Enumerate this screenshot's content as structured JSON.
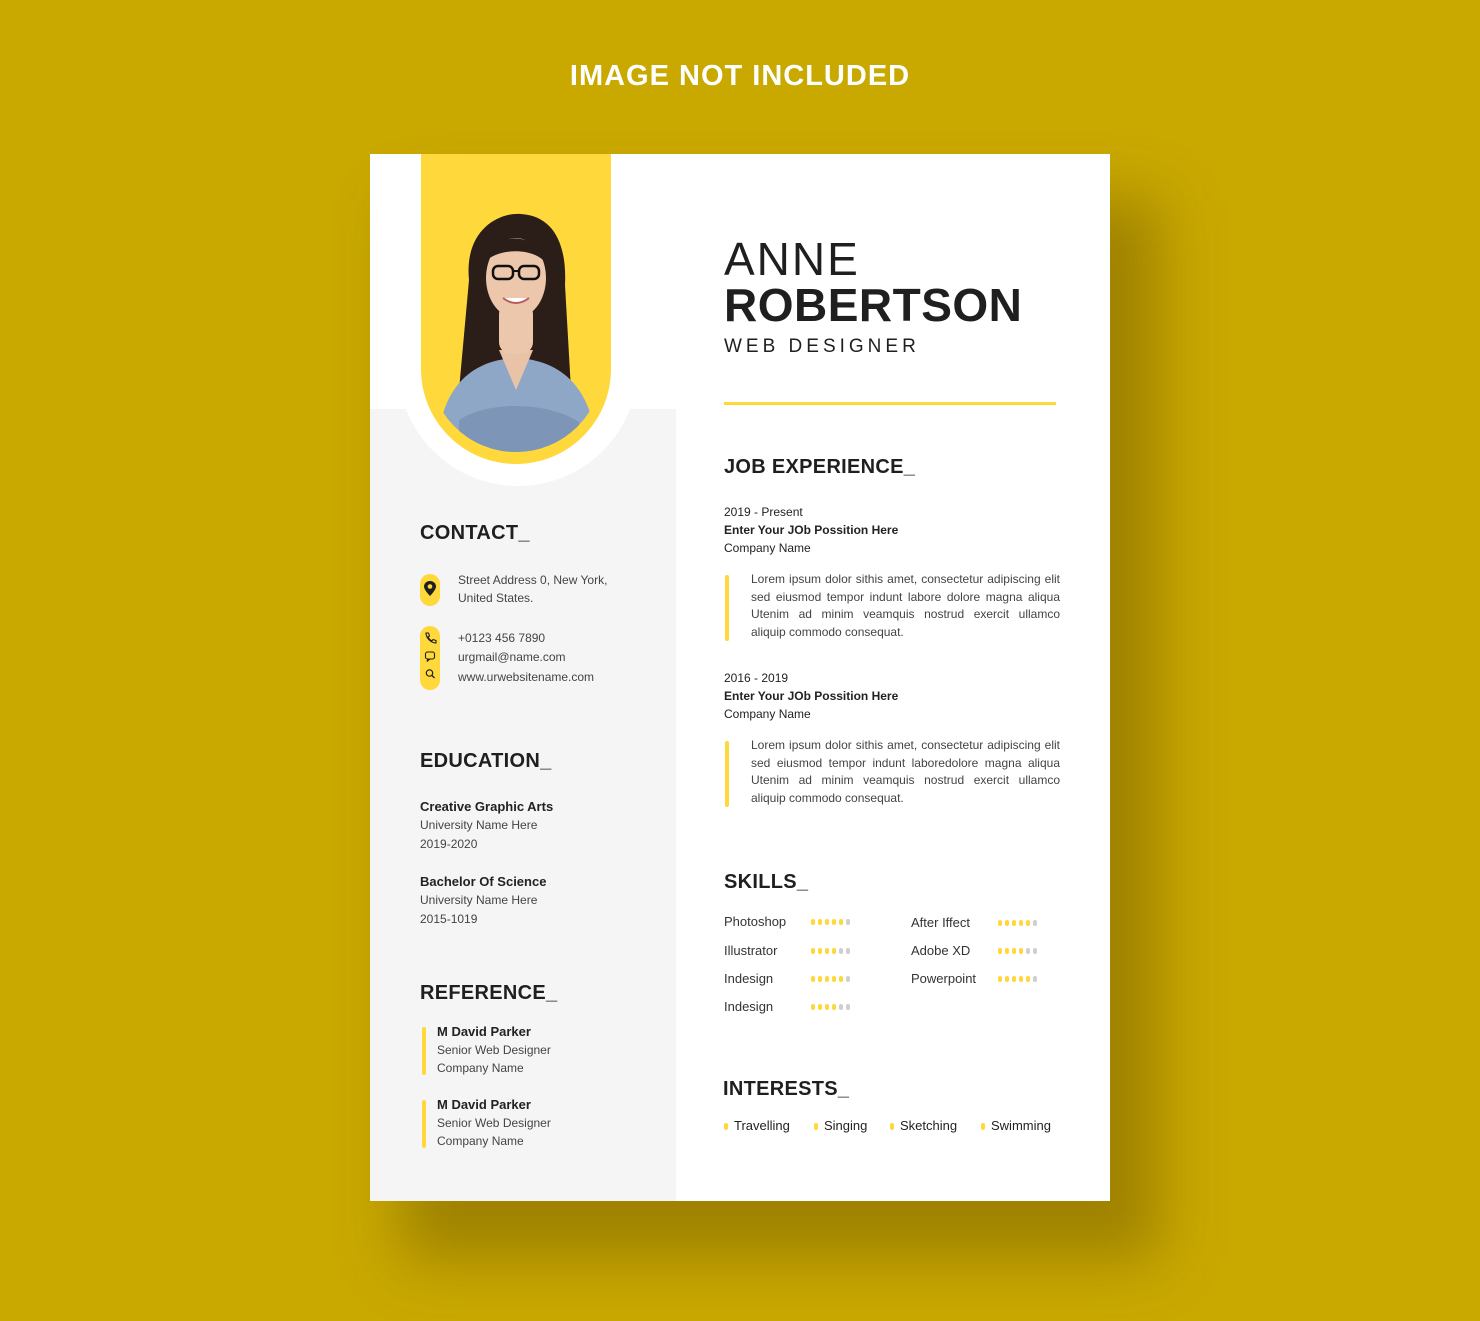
{
  "banner": "IMAGE NOT INCLUDED",
  "colors": {
    "background": "#c9a800",
    "accent": "#ffd83c",
    "text": "#1f1f1f"
  },
  "profile": {
    "first_name": "ANNE",
    "last_name": "ROBERTSON",
    "role": "WEB DESIGNER"
  },
  "contact": {
    "title": "CONTACT_",
    "address_line1": "Street Address 0, New York,",
    "address_line2": "United States.",
    "phone": "+0123 456 7890",
    "email": "urgmail@name.com",
    "website": "www.urwebsitename.com",
    "icons": [
      "location-pin-icon",
      "phone-icon",
      "chat-icon",
      "search-icon"
    ]
  },
  "education": {
    "title": "EDUCATION_",
    "items": [
      {
        "degree": "Creative Graphic Arts",
        "school": "University Name Here",
        "years": "2019-2020"
      },
      {
        "degree": "Bachelor Of Science",
        "school": "University Name Here",
        "years": "2015-1019"
      }
    ]
  },
  "reference": {
    "title": "REFERENCE_",
    "items": [
      {
        "name": "M David Parker",
        "role": "Senior Web Designer",
        "company": "Company Name"
      },
      {
        "name": "M David Parker",
        "role": "Senior Web Designer",
        "company": "Company Name"
      }
    ]
  },
  "experience": {
    "title": "JOB EXPERIENCE_",
    "items": [
      {
        "period": "2019 - Present",
        "position": "Enter Your JOb Possition Here",
        "company": "Company Name",
        "description": "Lorem ipsum dolor sithis amet, consectetur adipiscing elit sed eiusmod tempor indunt  labore dolore magna aliqua Utenim ad minim veamquis nostrud exercit ullamco aliquip commodo consequat."
      },
      {
        "period": "2016 - 2019",
        "position": "Enter Your JOb Possition Here",
        "company": "Company Name",
        "description": "Lorem ipsum dolor sithis amet, consectetur adipiscing elit sed eiusmod tempor indunt  laboredolore magna aliqua Utenim ad minim veamquis nostrud exercit ullamco aliquip commodo consequat."
      }
    ]
  },
  "skills": {
    "title": "SKILLS_",
    "items": [
      {
        "name": "Photoshop",
        "rating": 5,
        "max": 6
      },
      {
        "name": "Illustrator",
        "rating": 4,
        "max": 6
      },
      {
        "name": "Indesign",
        "rating": 5,
        "max": 6
      },
      {
        "name": "Indesign",
        "rating": 4,
        "max": 6
      },
      {
        "name": "After Iffect",
        "rating": 5,
        "max": 6
      },
      {
        "name": "Adobe XD",
        "rating": 4,
        "max": 6
      },
      {
        "name": "Powerpoint",
        "rating": 5,
        "max": 6
      }
    ]
  },
  "interests": {
    "title": "INTERESTS_",
    "items": [
      "Travelling",
      "Singing",
      "Sketching",
      "Swimming"
    ]
  }
}
